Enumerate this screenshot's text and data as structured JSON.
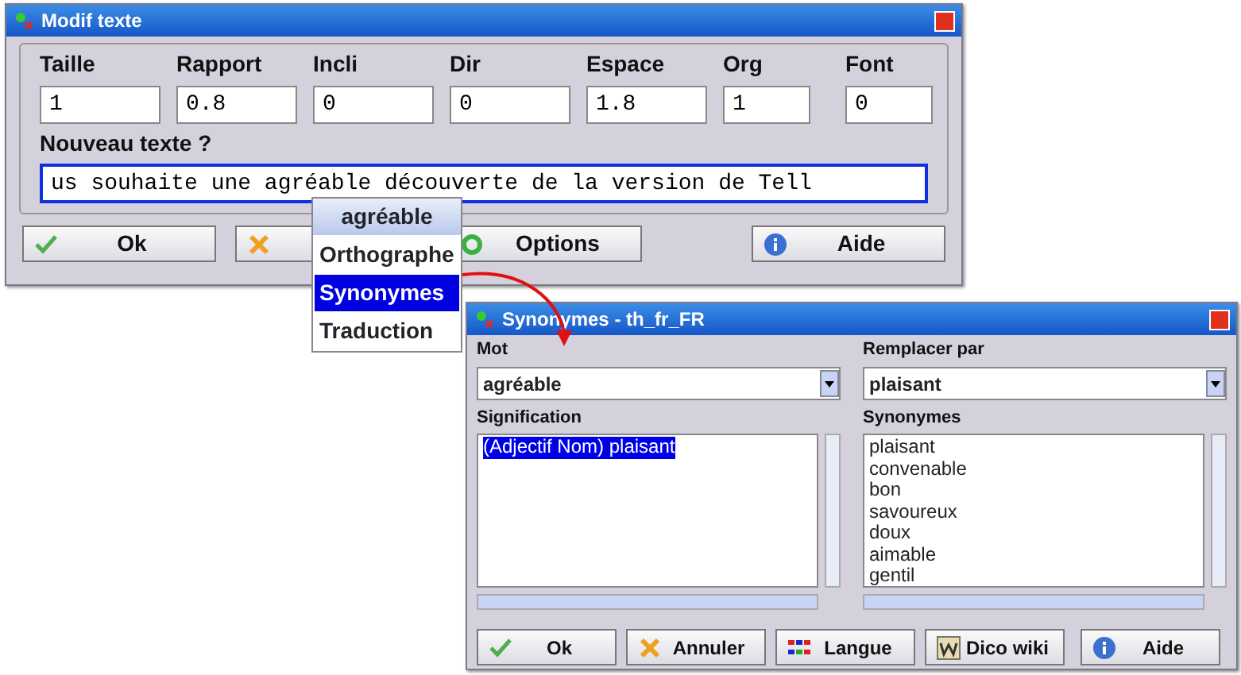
{
  "main_window": {
    "title": "Modif texte",
    "fields": [
      {
        "label": "Taille",
        "value": "1"
      },
      {
        "label": "Rapport",
        "value": "0.8"
      },
      {
        "label": "Incli",
        "value": "0"
      },
      {
        "label": "Dir",
        "value": "0"
      },
      {
        "label": "Espace",
        "value": "1.8"
      },
      {
        "label": "Org",
        "value": "1"
      },
      {
        "label": "Font",
        "value": "0"
      }
    ],
    "text_label": "Nouveau texte ?",
    "text_value": "us souhaite une agréable découverte de la version de Tell",
    "buttons": [
      {
        "label": "Ok",
        "kind": "ok"
      },
      {
        "kind": "cancel"
      },
      {
        "label": "Options",
        "kind": "options"
      },
      {
        "label": "Aide",
        "kind": "help"
      }
    ]
  },
  "context_menu": {
    "header": "agréable",
    "items": [
      {
        "label": "Orthographe",
        "selected": false
      },
      {
        "label": "Synonymes",
        "selected": true
      },
      {
        "label": "Traduction",
        "selected": false
      }
    ]
  },
  "synonyms_window": {
    "title": "Synonymes - th_fr_FR",
    "word_label": "Mot",
    "word_value": "agréable",
    "replace_label": "Remplacer par",
    "replace_value": "plaisant",
    "meaning_label": "Signification",
    "meanings": [
      {
        "text": "(Adjectif Nom) plaisant",
        "selected": true
      }
    ],
    "synonyms_label": "Synonymes",
    "synonyms": [
      {
        "text": "plaisant",
        "selected": false
      },
      {
        "text": "convenable",
        "selected": false
      },
      {
        "text": "bon",
        "selected": false
      },
      {
        "text": "savoureux",
        "selected": false
      },
      {
        "text": "doux",
        "selected": false
      },
      {
        "text": "aimable",
        "selected": false
      },
      {
        "text": "gentil",
        "selected": false
      }
    ],
    "buttons": [
      {
        "label": "Ok",
        "kind": "ok"
      },
      {
        "label": "Annuler",
        "kind": "cancel"
      },
      {
        "label": "Langue",
        "kind": "language"
      },
      {
        "label": "Dico wiki",
        "kind": "wiki"
      },
      {
        "label": "Aide",
        "kind": "help"
      }
    ]
  }
}
